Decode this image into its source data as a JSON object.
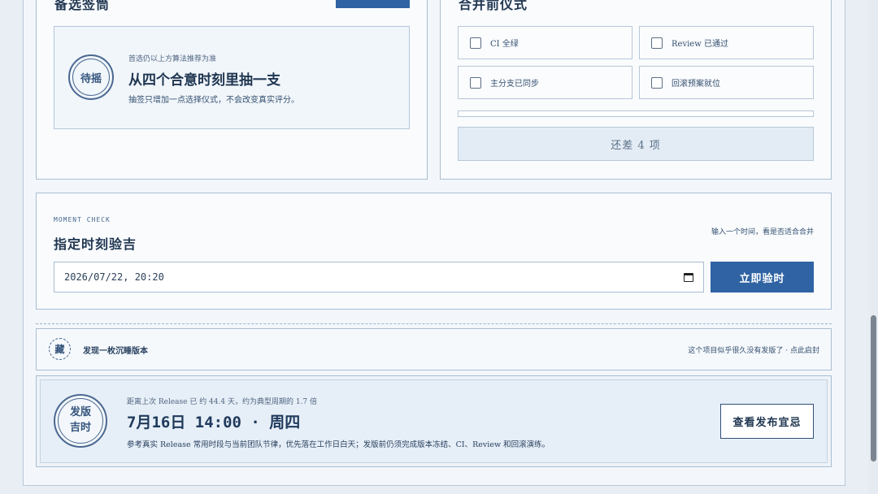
{
  "lot": {
    "title": "备选签筒",
    "seal": "待摇",
    "hint": "首选仍以上方算法推荐为准",
    "headline": "从四个合意时刻里抽一支",
    "desc": "抽签只增加一点选择仪式，不会改变真实评分。"
  },
  "ritual": {
    "title": "合并前仪式",
    "items": [
      {
        "label": "CI 全绿"
      },
      {
        "label": "Review 已通过"
      },
      {
        "label": "主分支已同步"
      },
      {
        "label": "回滚预案就位"
      }
    ],
    "remaining": "还差 4 项"
  },
  "moment": {
    "eyebrow": "MOMENT CHECK",
    "title": "指定时刻验吉",
    "note": "输入一个时间，看是否适合合并",
    "value": "2026/07/22, 20:20",
    "button": "立即验时"
  },
  "dormant": {
    "seal": "藏",
    "text": "发现一枚沉睡版本",
    "hint": "这个项目似乎很久没有发版了 · 点此启封"
  },
  "release": {
    "seal": "发版吉时",
    "seal_line1": "发版",
    "seal_line2": "吉时",
    "meta": "距离上次 Release 已 约 44.4 天，约为典型周期的 1.7 倍",
    "time": "7月16日 14:00 · 周四",
    "desc": "参考真实 Release 常用时段与当前团队节律，优先落在工作日白天；发版前仍须完成版本冻结、CI、Review 和回滚演练。",
    "button": "查看发布宜忌"
  },
  "colors": {
    "accent": "#2f63a3",
    "ink": "#1f3550",
    "card": "#f9fbfd"
  }
}
